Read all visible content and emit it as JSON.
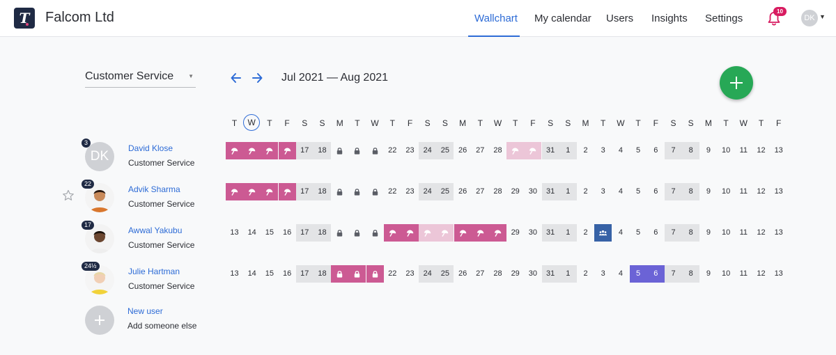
{
  "app": {
    "logo_letter": "T",
    "company": "Falcom Ltd",
    "nav": [
      "Wallchart",
      "My calendar",
      "Users",
      "Insights",
      "Settings"
    ],
    "notifications_count": "10",
    "user_initials": "DK"
  },
  "controls": {
    "team": "Customer Service",
    "date_range": "Jul 2021 — Aug 2021"
  },
  "weekdays": [
    "T",
    "W",
    "T",
    "F",
    "S",
    "S",
    "M",
    "T",
    "W",
    "T",
    "F",
    "S",
    "S",
    "M",
    "T",
    "W",
    "T",
    "F",
    "S",
    "S",
    "M",
    "T",
    "W",
    "T",
    "F",
    "S",
    "S",
    "M",
    "T",
    "W",
    "T",
    "F"
  ],
  "today_index": 1,
  "weekend_indices": [
    4,
    5,
    11,
    12,
    18,
    19,
    25,
    26
  ],
  "days": [
    "13",
    "14",
    "15",
    "16",
    "17",
    "18",
    "19",
    "20",
    "21",
    "22",
    "23",
    "24",
    "25",
    "26",
    "27",
    "28",
    "29",
    "30",
    "31",
    "1",
    "2",
    "3",
    "4",
    "5",
    "6",
    "7",
    "8",
    "9",
    "10",
    "11",
    "12",
    "13"
  ],
  "users": [
    {
      "name": "David Klose",
      "team": "Customer Service",
      "badge": "3",
      "avatar_initials": "DK",
      "starred": false,
      "cells": {
        "0": "vac",
        "1": "vac",
        "2": "vac",
        "3": "vac",
        "6": "lock",
        "7": "lock",
        "8": "lock",
        "16": "vac-pend",
        "17": "vac-pend"
      }
    },
    {
      "name": "Advik Sharma",
      "team": "Customer Service",
      "badge": "22",
      "avatar_initials": "",
      "starred": true,
      "cells": {
        "0": "vac",
        "1": "vac",
        "2": "vac",
        "3": "vac",
        "6": "lock",
        "7": "lock",
        "8": "lock"
      }
    },
    {
      "name": "Awwal Yakubu",
      "team": "Customer Service",
      "badge": "17",
      "avatar_initials": "",
      "starred": false,
      "cells": {
        "6": "lock",
        "7": "lock",
        "8": "lock",
        "9": "vac",
        "10": "vac",
        "11": "vac-pend",
        "12": "vac-pend",
        "13": "vac",
        "14": "vac",
        "15": "vac",
        "21": "meet"
      }
    },
    {
      "name": "Julie Hartman",
      "team": "Customer Service",
      "badge": "24½",
      "avatar_initials": "",
      "starred": false,
      "cells": {
        "6": "vac-lock",
        "7": "vac-lock",
        "8": "vac-lock",
        "23": "purple",
        "24": "purple"
      }
    }
  ],
  "new_user": {
    "label": "New user",
    "sublabel": "Add someone else"
  },
  "colors": {
    "accent": "#2d6bd6",
    "vacation": "#cc5a93",
    "vacation_pending": "#ecc6d8",
    "purple_leave": "#6b63d6",
    "meeting": "#3762a6",
    "weekend": "#e3e4e6",
    "fab": "#27a856"
  }
}
